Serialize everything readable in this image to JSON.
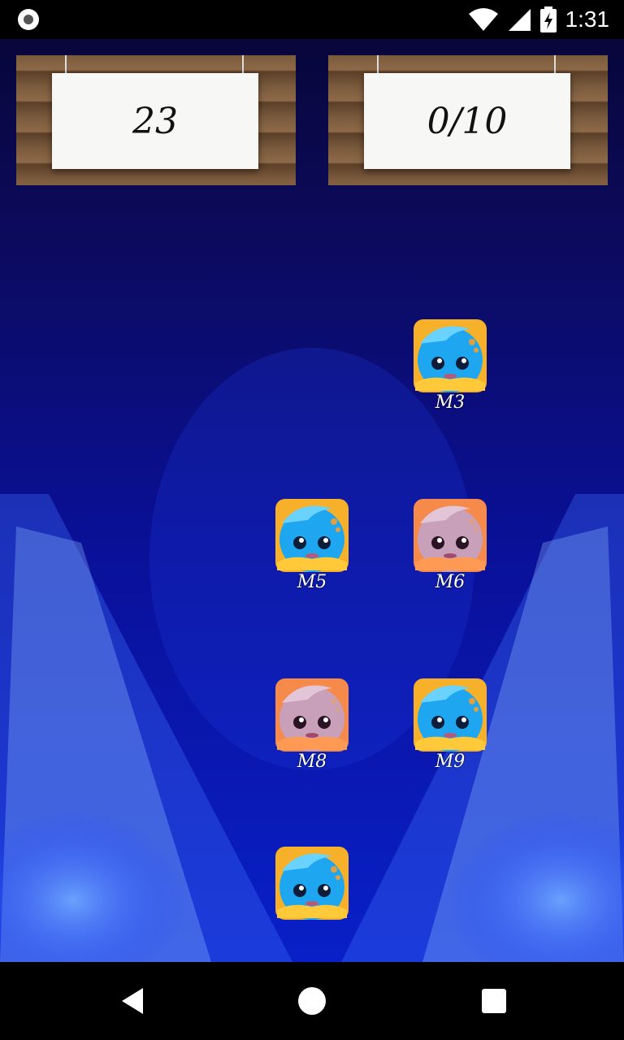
{
  "status_bar": {
    "time": "1:31",
    "icons": [
      "record-icon",
      "wifi-icon",
      "signal-icon",
      "battery-charging-icon"
    ]
  },
  "header": {
    "score": "23",
    "progress": "0/10"
  },
  "monsters": [
    {
      "label": "M3",
      "color": "blue"
    },
    {
      "label": "M5",
      "color": "blue"
    },
    {
      "label": "M6",
      "color": "pink"
    },
    {
      "label": "M8",
      "color": "pink"
    },
    {
      "label": "M9",
      "color": "blue"
    },
    {
      "label": "",
      "color": "blue"
    }
  ],
  "colors": {
    "blue_monster": "#1fa6f0",
    "pink_monster": "#c9a0b9",
    "tile_gold": "#f6b02a",
    "tile_orange": "#f58a4a"
  },
  "nav": {
    "icons": [
      "back-icon",
      "home-icon",
      "recents-icon"
    ]
  }
}
